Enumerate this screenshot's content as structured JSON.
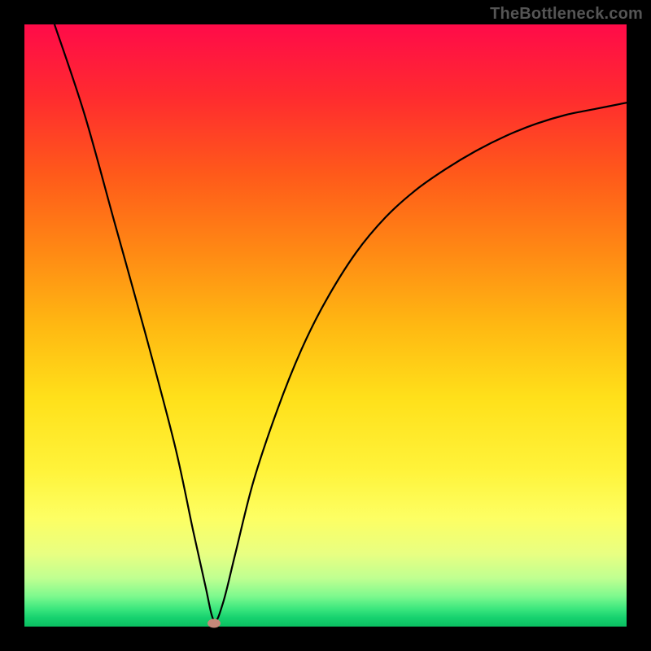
{
  "watermark": "TheBottleneck.com",
  "chart_data": {
    "type": "line",
    "title": "",
    "xlabel": "",
    "ylabel": "",
    "xlim": [
      0,
      100
    ],
    "ylim": [
      0,
      100
    ],
    "series": [
      {
        "name": "bottleneck-curve",
        "x": [
          5,
          10,
          15,
          20,
          25,
          28,
          30,
          31.5,
          33,
          35,
          38,
          42,
          46,
          50,
          55,
          60,
          65,
          70,
          75,
          80,
          85,
          90,
          95,
          100
        ],
        "values": [
          100,
          85,
          67,
          49,
          30,
          16,
          7,
          1,
          4,
          12,
          24,
          36,
          46,
          54,
          62,
          68,
          72.5,
          76,
          79,
          81.5,
          83.5,
          85,
          86,
          87
        ]
      }
    ],
    "marker": {
      "x": 31.5,
      "y": 0.6
    },
    "gradient_stops": [
      {
        "pos": 0.0,
        "color": "#ff0b49"
      },
      {
        "pos": 0.25,
        "color": "#ff5a1a"
      },
      {
        "pos": 0.5,
        "color": "#ffb812"
      },
      {
        "pos": 0.74,
        "color": "#fff33a"
      },
      {
        "pos": 0.95,
        "color": "#7cf98e"
      },
      {
        "pos": 1.0,
        "color": "#0abf61"
      }
    ]
  }
}
